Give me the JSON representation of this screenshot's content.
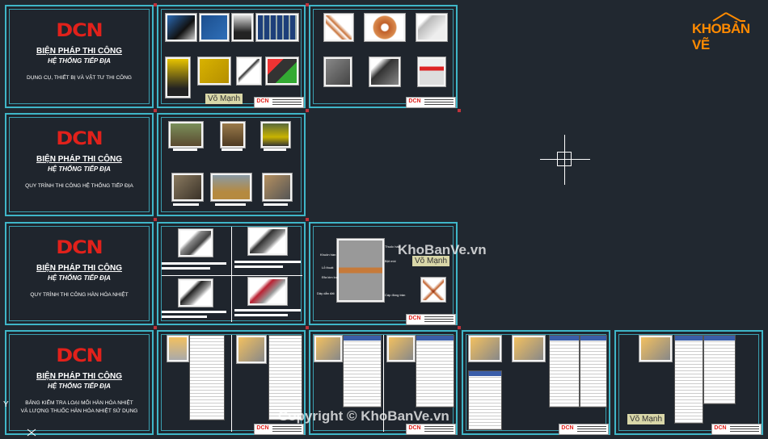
{
  "brand": {
    "logo_text": "KHOBANVE",
    "logo_part1": "KHO",
    "logo_part2": "BẢN VẼ",
    "accent": "#ff8a00"
  },
  "company_logo": "DCN",
  "sheets": [
    {
      "title": "BIỆN PHÁP THI CÔNG",
      "subtitle": "HỆ THỐNG TIẾP ĐỊA",
      "desc": "DỤNG CỤ, THIẾT BỊ VÀ VẬT TƯ THI CÔNG"
    },
    {
      "title": "BIỆN PHÁP THI CÔNG",
      "subtitle": "HỆ THỐNG TIẾP ĐỊA",
      "desc": "QUY TRÌNH THI CÔNG HỆ THỐNG TIẾP ĐỊA"
    },
    {
      "title": "BIỆN PHÁP THI CÔNG",
      "subtitle": "HỆ THỐNG TIẾP ĐỊA",
      "desc": "QUY TRÌNH THI CÔNG HÀN HÓA NHIỆT"
    },
    {
      "title": "BIỆN PHÁP THI CÔNG",
      "subtitle": "HỆ THỐNG TIẾP ĐỊA",
      "desc": "BẢNG KIỂM TRA LOẠI MỐI HÀN HÓA NHIỆT",
      "desc2": "VÀ LƯỢNG THUỐC HÀN HÓA NHIỆT SỬ DỤNG"
    }
  ],
  "tags": {
    "author1": "Võ Mạnh",
    "author2": "Võ Mạnh",
    "author3": "Võ Mạnh"
  },
  "watermarks": {
    "center": "KhoBanVe.vn",
    "copyright": "Copyright © KhoBanVe.vn"
  },
  "labels": {
    "l1": "Khuôn hàn",
    "l2": "Lỗ thoát",
    "l3": "Đĩa kim loại",
    "l4": "Dây dẫn đất",
    "l5": "Thuốc hàn",
    "l6": "Bột mồi",
    "l7": "Cáp đồng trần"
  },
  "ucs_label": "Y",
  "colors": {
    "frame": "#3fb6c8",
    "logo_red": "#e1211b",
    "background": "#212830"
  }
}
